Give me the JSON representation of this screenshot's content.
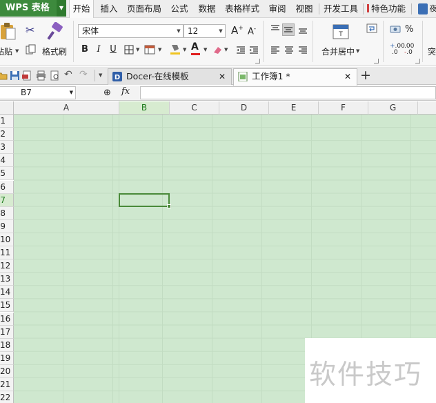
{
  "app": {
    "button_label": "WPS 表格"
  },
  "menu": {
    "items": [
      "开始",
      "插入",
      "页面布局",
      "公式",
      "数据",
      "表格样式",
      "审阅",
      "视图",
      "开发工具",
      "特色功能"
    ],
    "active": "开始",
    "partial_item": "夜"
  },
  "ribbon": {
    "paste_label": "粘贴",
    "format_painter_label": "格式刷",
    "font_name": "宋体",
    "font_size": "12",
    "grow_font": "A",
    "shrink_font": "A",
    "bold": "B",
    "italic": "I",
    "underline": "U",
    "merge_center_label": "合并居中",
    "percent": "%",
    "cut_glyph": "✂",
    "inc_decimal": ".00",
    "dec_decimal": ".00",
    "partial_label": "突"
  },
  "tabs": [
    {
      "title": "Docer-在线模板",
      "active": false
    },
    {
      "title": "工作簿1 *",
      "active": true
    }
  ],
  "new_tab_glyph": "+",
  "formula_bar": {
    "name_box": "B7",
    "fx_label": "fx",
    "value": ""
  },
  "sheet": {
    "columns": [
      "A",
      "B",
      "C",
      "D",
      "E",
      "F",
      "G"
    ],
    "selected_column": "B",
    "row_labels": [
      "1",
      "2",
      "3",
      "4",
      "5",
      "6",
      "7",
      "8",
      "9",
      "10",
      "11",
      "12",
      "13",
      "14",
      "15",
      "16",
      "17",
      "18",
      "19",
      "20",
      "21",
      "22"
    ],
    "selected_row": "7",
    "active_cell": "B7",
    "grid_color": "#cfe8cf",
    "selection_color": "#4a8a3a"
  },
  "watermark": {
    "text": "软件技巧"
  }
}
